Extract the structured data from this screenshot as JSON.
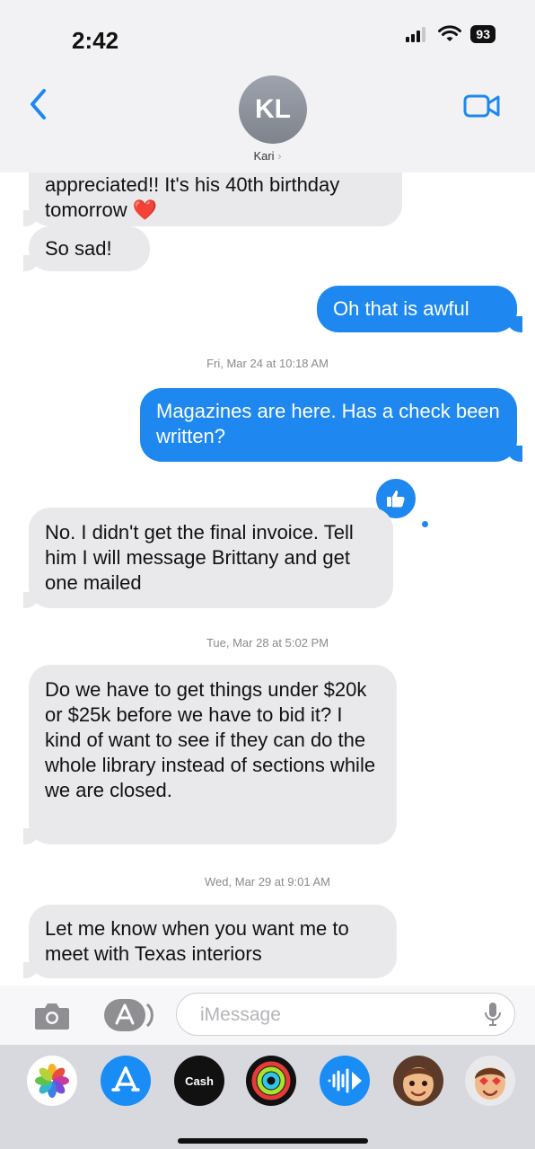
{
  "status_bar": {
    "time": "2:42",
    "battery": "93"
  },
  "header": {
    "avatar_initials": "KL",
    "contact_name": "Kari",
    "contact_chevron": "›",
    "back_icon": "chevron-left-icon",
    "video_icon": "video-camera-icon"
  },
  "thread": {
    "messages": [
      {
        "direction": "incoming",
        "text": "appreciated!! It's his 40th birthday tomorrow ❤️"
      },
      {
        "direction": "incoming",
        "text": "So sad!"
      },
      {
        "direction": "outgoing",
        "text": "Oh that is awful"
      },
      {
        "type": "timestamp",
        "text": "Fri, Mar 24 at 10:18 AM"
      },
      {
        "direction": "outgoing",
        "text": "Magazines are here. Has a check been written?",
        "reaction": "thumbs-up-icon"
      },
      {
        "direction": "incoming",
        "text": "No. I didn't get the final invoice. Tell him I will message Brittany and get one mailed"
      },
      {
        "type": "timestamp",
        "text": "Tue, Mar 28 at 5:02 PM"
      },
      {
        "direction": "incoming",
        "text": "Do we have to get things under $20k or $25k before we have to bid it? I kind of want to see if they can do the whole library instead of sections while we are closed."
      },
      {
        "type": "timestamp",
        "text": "Wed, Mar 29 at 9:01 AM"
      },
      {
        "direction": "incoming",
        "text": "Let me know when you want me to meet with Texas interiors"
      }
    ]
  },
  "input_bar": {
    "placeholder": "iMessage",
    "camera_icon": "camera-icon",
    "apps_icon": "app-store-icon",
    "mic_icon": "microphone-icon"
  },
  "app_drawer": {
    "apps": [
      {
        "icon": "photos-icon"
      },
      {
        "icon": "app-store-icon"
      },
      {
        "icon": "apple-cash-icon",
        "label": "Cash"
      },
      {
        "icon": "activity-rings-icon"
      },
      {
        "icon": "audio-message-icon"
      },
      {
        "icon": "memoji-icon"
      },
      {
        "icon": "memoji-stickers-icon"
      }
    ]
  },
  "colors": {
    "outgoing_bubble": "#1e88f0",
    "incoming_bubble": "#e9e9eb",
    "accent": "#1e88f0"
  }
}
